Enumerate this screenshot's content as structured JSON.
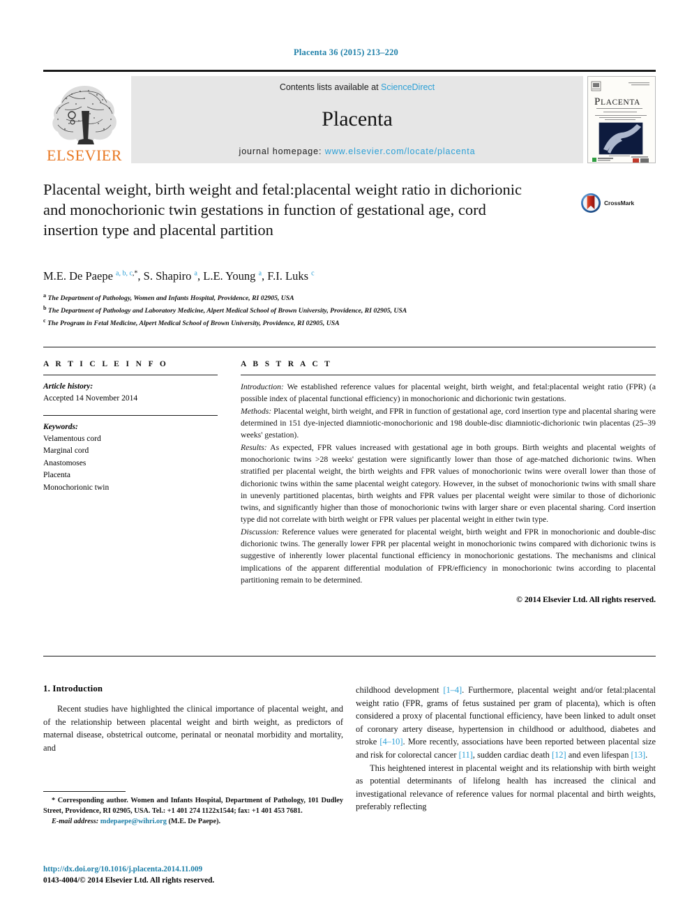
{
  "running_head": "Placenta 36 (2015) 213–220",
  "masthead": {
    "contents_prefix": "Contents lists available at",
    "contents_link": "ScienceDirect",
    "journal_name": "Placenta",
    "homepage_prefix": "journal homepage:",
    "homepage_url": "www.elsevier.com/locate/placenta",
    "publisher_logo_text": "ELSEVIER",
    "cover_title": "PLACENTA"
  },
  "article": {
    "title": "Placental weight, birth weight and fetal:placental weight ratio in dichorionic and monochorionic twin gestations in function of gestational age, cord insertion type and placental partition",
    "crossmark_label": "CrossMark",
    "authors_html": "M.E. De Paepe <sup>a, b, c</sup><sup class=\"star\">,*</sup>, S. Shapiro <sup>a</sup>, L.E. Young <sup>a</sup>, F.I. Luks <sup>c</sup>",
    "affiliations": [
      {
        "marker": "a",
        "text": "The Department of Pathology, Women and Infants Hospital, Providence, RI 02905, USA"
      },
      {
        "marker": "b",
        "text": "The Department of Pathology and Laboratory Medicine, Alpert Medical School of Brown University, Providence, RI 02905, USA"
      },
      {
        "marker": "c",
        "text": "The Program in Fetal Medicine, Alpert Medical School of Brown University, Providence, RI 02905, USA"
      }
    ]
  },
  "article_info": {
    "heading": "A R T I C L E   I N F O",
    "history_label": "Article history:",
    "history_value": "Accepted 14 November 2014",
    "keywords_label": "Keywords:",
    "keywords": [
      "Velamentous cord",
      "Marginal cord",
      "Anastomoses",
      "Placenta",
      "Monochorionic twin"
    ]
  },
  "abstract": {
    "heading": "A B S T R A C T",
    "sections": [
      {
        "label": "Introduction:",
        "text": " We established reference values for placental weight, birth weight, and fetal:placental weight ratio (FPR) (a possible index of placental functional efficiency) in monochorionic and dichorionic twin gestations."
      },
      {
        "label": "Methods:",
        "text": " Placental weight, birth weight, and FPR in function of gestational age, cord insertion type and placental sharing were determined in 151 dye-injected diamniotic-monochorionic and 198 double-disc diamniotic-dichorionic twin placentas (25–39 weeks' gestation)."
      },
      {
        "label": "Results:",
        "text": " As expected, FPR values increased with gestational age in both groups. Birth weights and placental weights of monochorionic twins >28 weeks' gestation were significantly lower than those of age-matched dichorionic twins. When stratified per placental weight, the birth weights and FPR values of monochorionic twins were overall lower than those of dichorionic twins within the same placental weight category. However, in the subset of monochorionic twins with small share in unevenly partitioned placentas, birth weights and FPR values per placental weight were similar to those of dichorionic twins, and significantly higher than those of monochorionic twins with larger share or even placental sharing. Cord insertion type did not correlate with birth weight or FPR values per placental weight in either twin type."
      },
      {
        "label": "Discussion:",
        "text": " Reference values were generated for placental weight, birth weight and FPR in monochorionic and double-disc dichorionic twins. The generally lower FPR per placental weight in monochorionic twins compared with dichorionic twins is suggestive of inherently lower placental functional efficiency in monochorionic gestations. The mechanisms and clinical implications of the apparent differential modulation of FPR/efficiency in monochorionic twins according to placental partitioning remain to be determined."
      }
    ],
    "copyright": "© 2014 Elsevier Ltd. All rights reserved."
  },
  "body": {
    "section_heading": "1. Introduction",
    "left_paragraph": "Recent studies have highlighted the clinical importance of placental weight, and of the relationship between placental weight and birth weight, as predictors of maternal disease, obstetrical outcome, perinatal or neonatal morbidity and mortality, and",
    "right_paragraph_1_html": "childhood development <span class=\"ref\">[1–4]</span>. Furthermore, placental weight and/or fetal:placental weight ratio (FPR, grams of fetus sustained per gram of placenta), which is often considered a proxy of placental functional efficiency, have been linked to adult onset of coronary artery disease, hypertension in childhood or adulthood, diabetes and stroke <span class=\"ref\">[4–10]</span>. More recently, associations have been reported between placental size and risk for colorectal cancer <span class=\"ref\">[11]</span>, sudden cardiac death <span class=\"ref\">[12]</span> and even lifespan <span class=\"ref\">[13]</span>.",
    "right_paragraph_2": "This heightened interest in placental weight and its relationship with birth weight as potential determinants of lifelong health has increased the clinical and investigational relevance of reference values for normal placental and birth weights, preferably reflecting"
  },
  "footnotes": {
    "corresponding_html": "* Corresponding author. Women and Infants Hospital, Department of Pathology, 101 Dudley Street, Providence, RI 02905, USA. Tel.: +1 401 274 1122x1544; fax: +1 401 453 7681.",
    "email_label": "E-mail address:",
    "email_address": "mdepaepe@wihri.org",
    "email_suffix": "(M.E. De Paepe).",
    "doi_url": "http://dx.doi.org/10.1016/j.placenta.2014.11.009",
    "issn_line": "0143-4004/© 2014 Elsevier Ltd. All rights reserved."
  },
  "colors": {
    "link": "#1d7fa8",
    "sciencedirect": "#2a9fd6",
    "elsevier_orange": "#e87722",
    "masthead_bg": "#e6e6e6"
  }
}
